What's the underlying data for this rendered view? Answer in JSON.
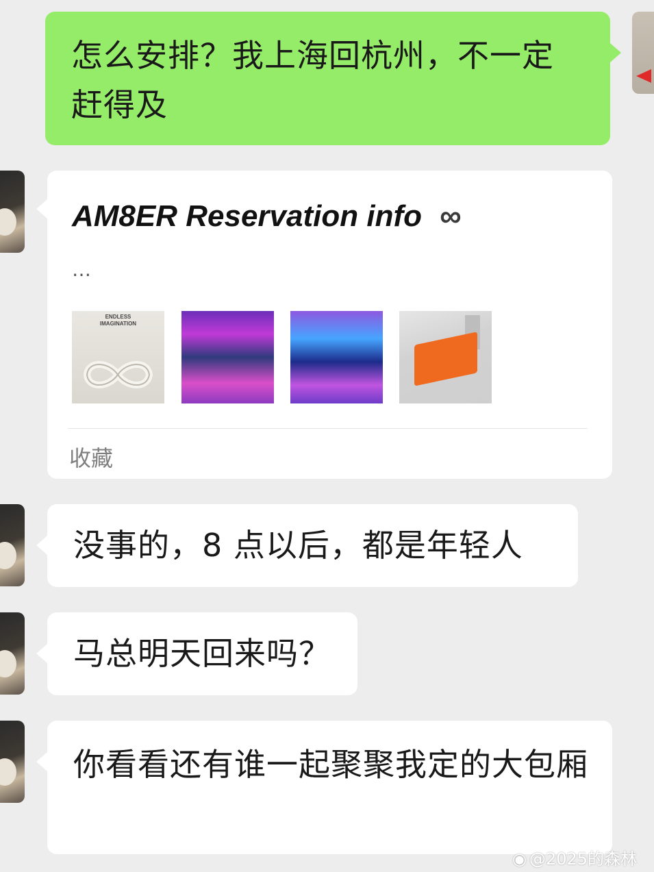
{
  "chat": {
    "messages": [
      {
        "id": "m1",
        "side": "sent",
        "text": "怎么安排？我上海回杭州，不一定赶得及"
      },
      {
        "id": "m2",
        "side": "received",
        "type": "card",
        "card": {
          "title": "AM8ER Reservation info",
          "title_symbol": "∞",
          "ellipsis": "…",
          "thumbnail_text": "ENDLESS\nIMAGINATION",
          "footer": "收藏"
        }
      },
      {
        "id": "m3",
        "side": "received",
        "text": "没事的，8 点以后，都是年轻人"
      },
      {
        "id": "m4",
        "side": "received",
        "text": "马总明天回来吗？"
      },
      {
        "id": "m5",
        "side": "received",
        "text": "你看看还有谁一起聚聚我定的大包厢"
      }
    ]
  },
  "watermark": {
    "icon": "weibo-icon",
    "text": "@2025的森林"
  },
  "colors": {
    "sent_bubble": "#95ec69",
    "received_bubble": "#ffffff",
    "background": "#ededed"
  }
}
